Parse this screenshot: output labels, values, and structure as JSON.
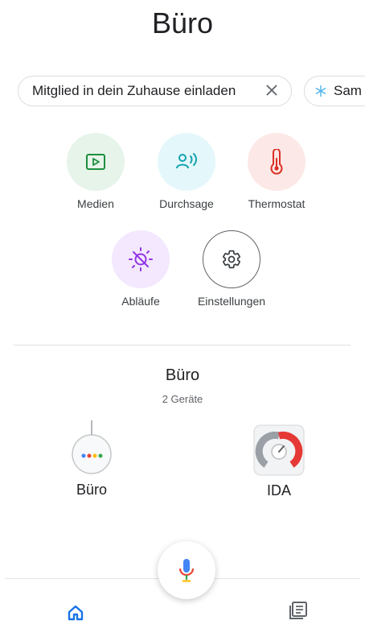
{
  "header": {
    "title": "Büro"
  },
  "chips": [
    {
      "label": "Mitglied in dein Zuhause einladen",
      "icon": "close-icon"
    },
    {
      "label": "Sam",
      "icon": "snowflake-icon"
    }
  ],
  "actions": [
    {
      "label": "Medien",
      "icon": "media-icon",
      "bg": "#e6f4ea",
      "fg": "#1e8e3e"
    },
    {
      "label": "Durchsage",
      "icon": "broadcast-icon",
      "bg": "#e4f7fb",
      "fg": "#12a4af"
    },
    {
      "label": "Thermostat",
      "icon": "thermometer-icon",
      "bg": "#fce8e6",
      "fg": "#d93025"
    },
    {
      "label": "Abläufe",
      "icon": "routines-icon",
      "bg": "#f3e8fd",
      "fg": "#9334e6"
    },
    {
      "label": "Einstellungen",
      "icon": "gear-icon",
      "bg": "#ffffff",
      "fg": "#3c4043"
    }
  ],
  "room": {
    "name": "Büro",
    "device_count": "2 Geräte"
  },
  "devices": [
    {
      "name": "Büro",
      "icon": "google-home-mini-icon"
    },
    {
      "name": "IDA",
      "icon": "gauge-app-icon"
    }
  ],
  "bottom_nav": {
    "home_icon": "home-icon",
    "feed_icon": "feed-icon",
    "mic_icon": "mic-icon"
  }
}
